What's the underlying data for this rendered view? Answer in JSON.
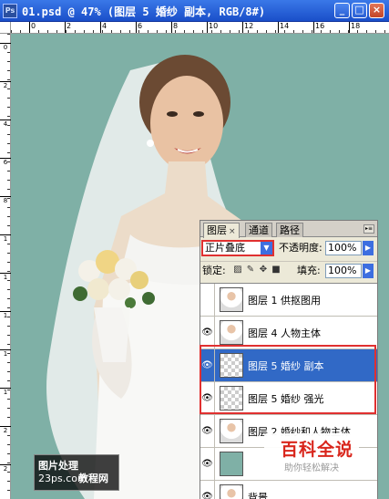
{
  "window": {
    "title": "01.psd @ 47% (图层 5 婚纱 副本, RGB/8#)",
    "app_icon": "Ps",
    "buttons": {
      "minimize": "_",
      "maximize": "□",
      "close": "×"
    }
  },
  "ruler": {
    "top_ticks": [
      "0",
      "2",
      "4",
      "6",
      "8",
      "10",
      "12",
      "14",
      "16",
      "18"
    ],
    "left_ticks": [
      "0",
      "2",
      "4",
      "6",
      "8",
      "1",
      "1",
      "1",
      "1",
      "1",
      "2",
      "2"
    ]
  },
  "layers_panel": {
    "tabs": [
      {
        "label": "图层",
        "close": "×"
      },
      {
        "label": "通道"
      },
      {
        "label": "路径"
      }
    ],
    "blend_mode": "正片叠底",
    "opacity_label": "不透明度:",
    "opacity_value": "100%",
    "lock_label": "锁定:",
    "fill_label": "填充:",
    "fill_value": "100%",
    "layers": [
      {
        "name": "图层 1  供抠图用",
        "visible": false,
        "selected": false,
        "thumb": "portrait"
      },
      {
        "name": "图层 4  人物主体",
        "visible": true,
        "selected": false,
        "thumb": "portrait"
      },
      {
        "name": "图层 5 婚纱 副本",
        "visible": true,
        "selected": true,
        "thumb": "checker"
      },
      {
        "name": "图层 5 婚纱  强光",
        "visible": true,
        "selected": false,
        "thumb": "checker"
      },
      {
        "name": "图层 2 婚纱和人物主体",
        "visible": true,
        "selected": false,
        "thumb": "portrait"
      },
      {
        "name": "",
        "visible": true,
        "selected": false,
        "thumb": "teal"
      },
      {
        "name": "背景",
        "visible": true,
        "selected": false,
        "thumb": "portrait"
      }
    ]
  },
  "watermarks": {
    "left_line1": "图片处理",
    "left_line2": "23ps.com",
    "left_line3": "教程网",
    "right_big": "百科全说",
    "right_small": "助你轻松解决"
  },
  "colors": {
    "canvas_bg": "#7fb0a6",
    "selection": "#3169c6",
    "highlight": "#e03030",
    "titlebar": "#1a4fc9"
  }
}
